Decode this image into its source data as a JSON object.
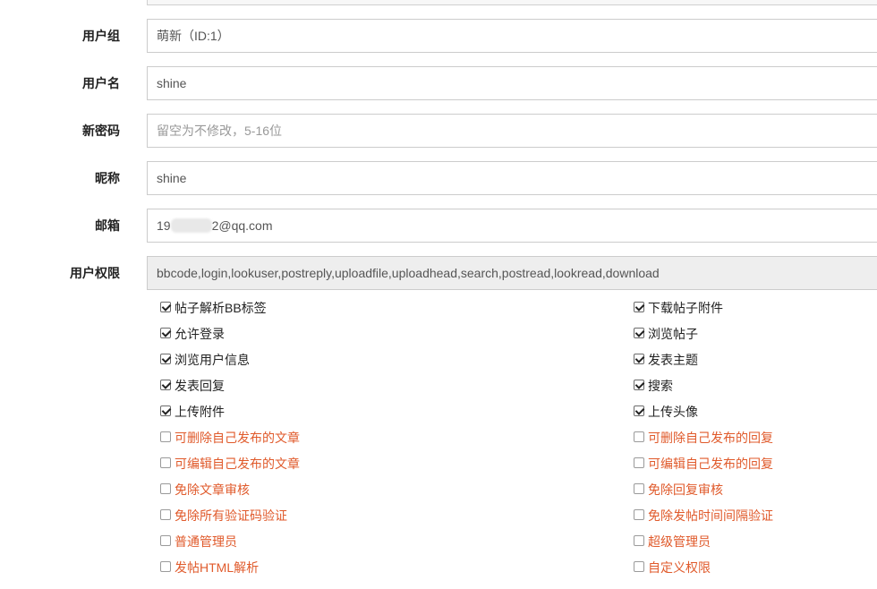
{
  "form": {
    "group": {
      "label": "用户组",
      "value": "萌新（ID:1）"
    },
    "username": {
      "label": "用户名",
      "value": "shine"
    },
    "password": {
      "label": "新密码",
      "placeholder": "留空为不修改，5-16位"
    },
    "nickname": {
      "label": "昵称",
      "value": "shine"
    },
    "email": {
      "label": "邮箱",
      "value_prefix": "19",
      "value_suffix": "2@qq.com"
    },
    "permissions": {
      "label": "用户权限",
      "value": "bbcode,login,lookuser,postreply,uploadfile,uploadhead,search,postread,lookread,download"
    }
  },
  "permission_items": {
    "left": [
      {
        "label": "帖子解析BB标签",
        "checked": true,
        "admin": false
      },
      {
        "label": "允许登录",
        "checked": true,
        "admin": false
      },
      {
        "label": "浏览用户信息",
        "checked": true,
        "admin": false
      },
      {
        "label": "发表回复",
        "checked": true,
        "admin": false
      },
      {
        "label": "上传附件",
        "checked": true,
        "admin": false
      },
      {
        "label": "可删除自己发布的文章",
        "checked": false,
        "admin": true
      },
      {
        "label": "可编辑自己发布的文章",
        "checked": false,
        "admin": true
      },
      {
        "label": "免除文章审核",
        "checked": false,
        "admin": true
      },
      {
        "label": "免除所有验证码验证",
        "checked": false,
        "admin": true
      },
      {
        "label": "普通管理员",
        "checked": false,
        "admin": true
      },
      {
        "label": "发帖HTML解析",
        "checked": false,
        "admin": true
      }
    ],
    "right": [
      {
        "label": "下载帖子附件",
        "checked": true,
        "admin": false
      },
      {
        "label": "浏览帖子",
        "checked": true,
        "admin": false
      },
      {
        "label": "发表主题",
        "checked": true,
        "admin": false
      },
      {
        "label": "搜索",
        "checked": true,
        "admin": false
      },
      {
        "label": "上传头像",
        "checked": true,
        "admin": false
      },
      {
        "label": "可删除自己发布的回复",
        "checked": false,
        "admin": true
      },
      {
        "label": "可编辑自己发布的回复",
        "checked": false,
        "admin": true
      },
      {
        "label": "免除回复审核",
        "checked": false,
        "admin": true
      },
      {
        "label": "免除发帖时间间隔验证",
        "checked": false,
        "admin": true
      },
      {
        "label": "超级管理员",
        "checked": false,
        "admin": true
      },
      {
        "label": "自定义权限",
        "checked": false,
        "admin": true
      }
    ]
  },
  "colors": {
    "admin_text": "#e05a2b",
    "readonly_bg": "#eeeeee"
  }
}
